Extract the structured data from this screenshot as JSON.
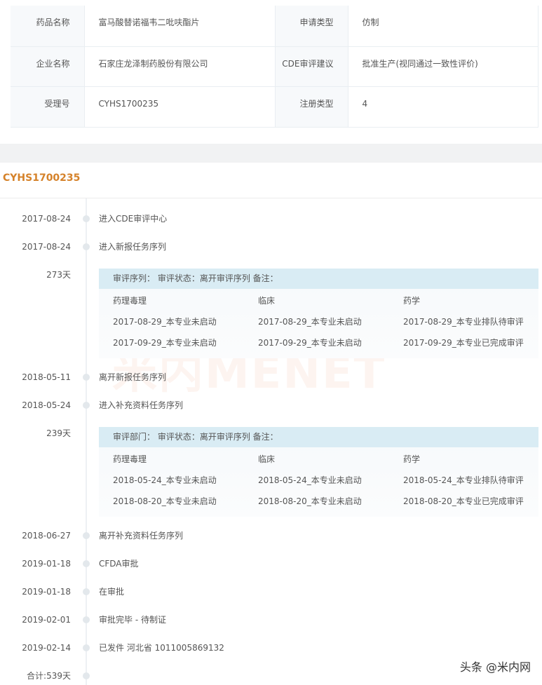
{
  "info": {
    "rows": [
      {
        "l1": "药品名称",
        "v1": "富马酸替诺福韦二吡呋酯片",
        "l2": "申请类型",
        "v2": "仿制"
      },
      {
        "l1": "企业名称",
        "v1": "石家庄龙泽制药股份有限公司",
        "l2": "CDE审评建议",
        "v2": "批准生产(视同通过一致性评价)"
      },
      {
        "l1": "受理号",
        "v1": "CYHS1700235",
        "l2": "注册类型",
        "v2": "4"
      }
    ]
  },
  "code": "CYHS1700235",
  "events": [
    {
      "date": "2017-08-24",
      "text": "进入CDE审评中心"
    },
    {
      "date": "2017-08-24",
      "text": "进入新报任务序列"
    },
    {
      "date": "2018-05-11",
      "text": "离开新报任务序列"
    },
    {
      "date": "2018-05-24",
      "text": "进入补充资料任务序列"
    },
    {
      "date": "2018-06-27",
      "text": "离开补充资料任务序列"
    },
    {
      "date": "2019-01-18",
      "text": "CFDA审批"
    },
    {
      "date": "2019-01-18",
      "text": "在审批"
    },
    {
      "date": "2019-02-01",
      "text": "审批完毕 - 待制证"
    },
    {
      "date": "2019-02-14",
      "text": "已发件 河北省 1011005869132"
    }
  ],
  "boxes": [
    {
      "days": "273天",
      "header": "审评序列：  审评状态：离开审评序列  备注：",
      "cols": [
        "药理毒理",
        "临床",
        "药学"
      ],
      "rows": [
        [
          "2017-08-29_本专业未启动",
          "2017-08-29_本专业未启动",
          "2017-08-29_本专业排队待审评"
        ],
        [
          "2017-09-29_本专业未启动",
          "2017-09-29_本专业未启动",
          "2017-09-29_本专业已完成审评"
        ]
      ]
    },
    {
      "days": "239天",
      "header": "审评部门：  审评状态：离开审评序列  备注：",
      "cols": [
        "药理毒理",
        "临床",
        "药学"
      ],
      "rows": [
        [
          "2018-05-24_本专业未启动",
          "2018-05-24_本专业未启动",
          "2018-05-24_本专业排队待审评"
        ],
        [
          "2018-08-20_本专业未启动",
          "2018-08-20_本专业未启动",
          "2018-08-20_本专业已完成审评"
        ]
      ]
    }
  ],
  "total": "合计:539天",
  "watermark": "米内MENET",
  "attribution": "头条 @米内网"
}
